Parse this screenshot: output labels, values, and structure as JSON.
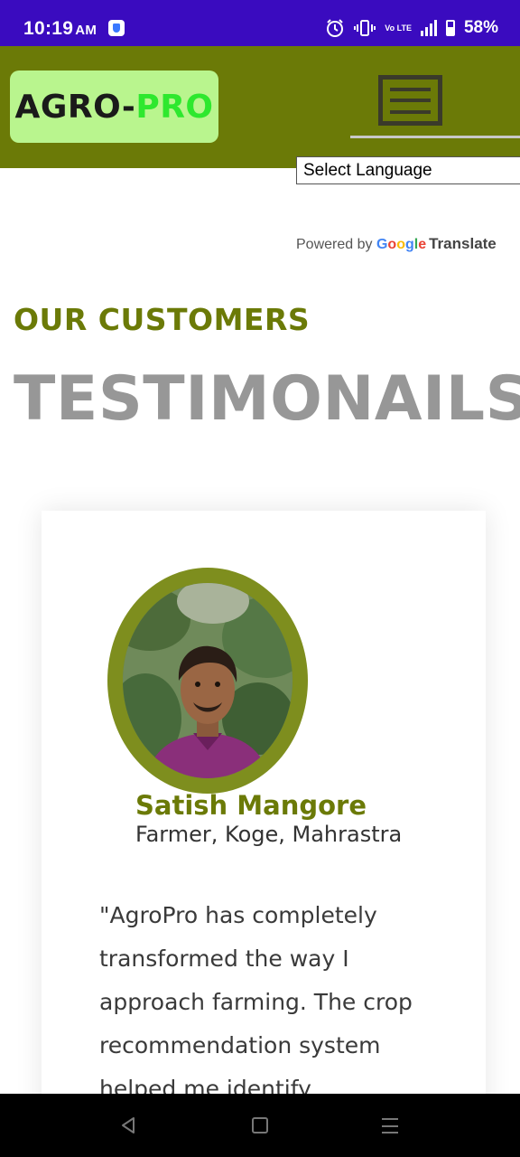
{
  "status_bar": {
    "time": "10:19",
    "ampm": "AM",
    "battery_percent": "58%",
    "volte_label": "Vo LTE",
    "lte_label": "LTE"
  },
  "header": {
    "logo_part1": "AGRO-",
    "logo_part2": "PRO",
    "menu_icon": "hamburger-menu-icon"
  },
  "translate": {
    "select_label": "Select Language",
    "powered_by": "Powered by",
    "google": "Google",
    "translate": "Translate"
  },
  "section": {
    "eyebrow": "OUR CUSTOMERS",
    "title": "TESTIMONAILS"
  },
  "testimonial": {
    "name": "Satish Mangore",
    "role": "Farmer, Koge, Mahrastra",
    "quote": "\"AgroPro has completely transformed the way I approach farming. The crop recommendation system helped me identify"
  },
  "colors": {
    "status_bar": "#3a0bbf",
    "brand_olive": "#6b7a07",
    "logo_bg": "#b9f58e",
    "logo_green": "#2ee82e",
    "heading_grey": "#979797"
  }
}
